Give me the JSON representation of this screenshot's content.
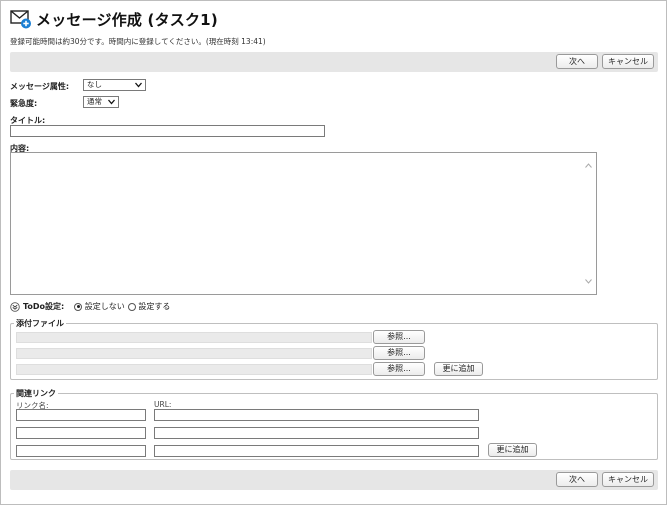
{
  "header": {
    "title": "メッセージ作成 (タスク1)",
    "notice": "登録可能時間は約30分です。時間内に登録してください。(現在時刻  13:41)"
  },
  "toolbar": {
    "next_label": "次へ",
    "cancel_label": "キャンセル"
  },
  "form": {
    "attribute_label": "メッセージ属性:",
    "attribute_value": "なし",
    "urgency_label": "緊急度:",
    "urgency_value": "通常",
    "title_label": "タイトル:",
    "title_value": "",
    "content_label": "内容:",
    "content_value": ""
  },
  "todo": {
    "label": "ToDo設定:",
    "options": [
      "設定しない",
      "設定する"
    ],
    "selected": "設定しない"
  },
  "attachments": {
    "legend": "添付ファイル",
    "browse_label": "参照...",
    "add_more_label": "更に追加"
  },
  "links": {
    "legend": "関連リンク",
    "name_header": "リンク名:",
    "url_header": "URL:",
    "add_more_label": "更に追加"
  },
  "colors": {
    "bar_bg": "#e6e6e6",
    "icon_badge": "#1a7fd4"
  }
}
